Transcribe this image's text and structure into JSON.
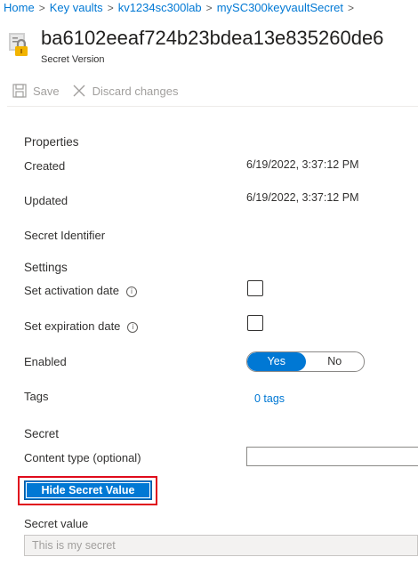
{
  "breadcrumb": [
    "Home",
    "Key vaults",
    "kv1234sc300lab",
    "mySC300keyvaultSecret"
  ],
  "breadcrumb_separator": ">",
  "header": {
    "title": "ba6102eeaf724b23bdea13e835260de6",
    "subtitle": "Secret Version",
    "icon": "key-lock-icon"
  },
  "toolbar": {
    "save_label": "Save",
    "discard_label": "Discard changes"
  },
  "properties": {
    "heading": "Properties",
    "created_label": "Created",
    "created_value": "6/19/2022, 3:37:12 PM",
    "updated_label": "Updated",
    "updated_value": "6/19/2022, 3:37:12 PM",
    "identifier_label": "Secret Identifier"
  },
  "settings": {
    "heading": "Settings",
    "activation_label": "Set activation date",
    "expiration_label": "Set expiration date",
    "info_glyph": "i",
    "activation_checked": false,
    "expiration_checked": false,
    "enabled_label": "Enabled",
    "enabled_yes": "Yes",
    "enabled_no": "No",
    "enabled_selected": "Yes",
    "tags_label": "Tags",
    "tags_value": "0 tags"
  },
  "secret": {
    "heading": "Secret",
    "content_type_label": "Content type (optional)",
    "content_type_value": "",
    "hide_button_label": "Hide Secret Value",
    "value_label": "Secret value",
    "value": "This is my secret"
  },
  "colors": {
    "accent": "#0078d4",
    "highlight": "#e00b1c",
    "disabled_text": "#a19f9d"
  }
}
